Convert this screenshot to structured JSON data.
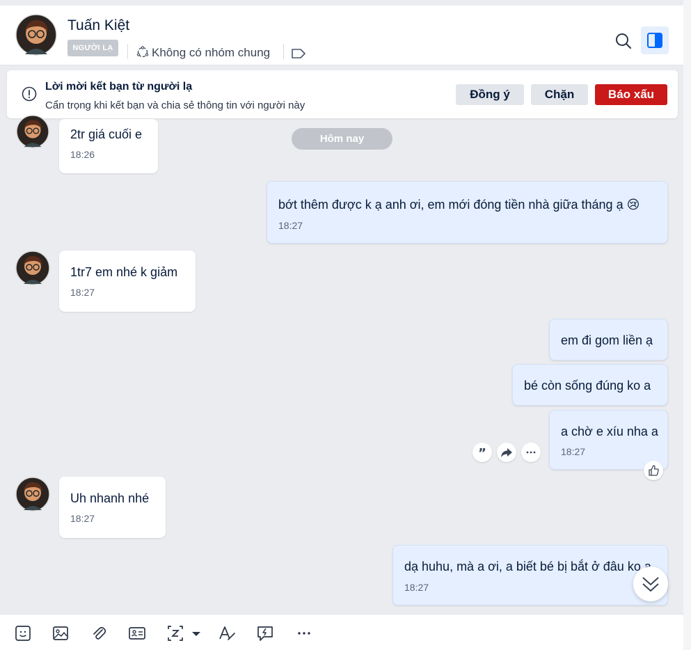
{
  "header": {
    "contact_name": "Tuấn Kiệt",
    "stranger_badge": "NGƯỜI LẠ",
    "common_groups": "Không có nhóm chung"
  },
  "banner": {
    "title": "Lời mời kết bạn từ người lạ",
    "subtitle": "Cẩn trọng khi kết bạn và chia sẻ thông tin với người này",
    "accept_label": "Đồng ý",
    "block_label": "Chặn",
    "report_label": "Báo xấu"
  },
  "date_divider": "Hôm nay",
  "messages": [
    {
      "direction": "in",
      "text": "2tr giá cuối e",
      "time": "18:26"
    },
    {
      "direction": "out",
      "text": "bớt thêm được k ạ anh ơi, em mới đóng tiền nhà giữa tháng ạ",
      "emoji": "😢",
      "time": "18:27"
    },
    {
      "direction": "in",
      "text": "1tr7 em nhé k giảm",
      "time": "18:27"
    },
    {
      "direction": "out",
      "text": "em đi gom liền ạ"
    },
    {
      "direction": "out",
      "text": "bé còn sống đúng ko a"
    },
    {
      "direction": "out",
      "text": "a chờ e xíu nha a",
      "time": "18:27"
    },
    {
      "direction": "in",
      "text": "Uh nhanh nhé",
      "time": "18:27"
    },
    {
      "direction": "out",
      "text": "dạ huhu, mà a ơi, a biết bé bị bắt ở đâu ko a",
      "time": "18:27"
    }
  ],
  "colors": {
    "accent": "#0068ff",
    "report_red": "#c91919",
    "outgoing_bubble": "#e5efff",
    "chat_background": "#ebecf0"
  },
  "icons": {
    "search": "search-icon",
    "panel": "sidebar-panel-icon",
    "info": "info-icon",
    "group": "group-icon",
    "tag": "tag-icon"
  }
}
